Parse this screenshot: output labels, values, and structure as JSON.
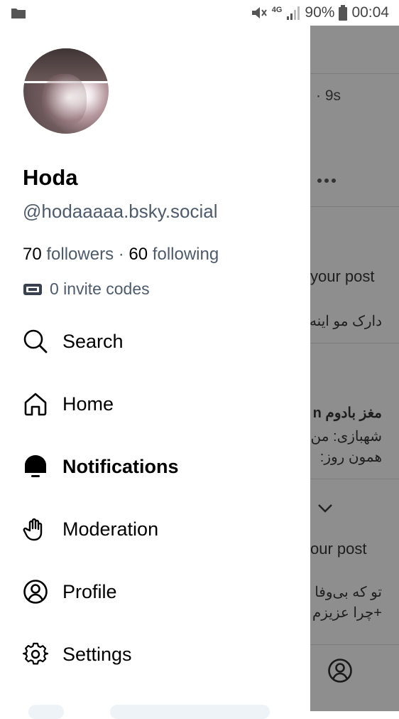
{
  "status_bar": {
    "battery": "90%",
    "time": "00:04",
    "network": "4G",
    "icons": [
      "folder-icon",
      "mute-icon",
      "signal-icon",
      "battery-icon"
    ]
  },
  "profile": {
    "display_name": "Hoda",
    "handle": "@hodaaaaa.bsky.social",
    "followers_count": "70",
    "followers_label": "followers",
    "separator": "·",
    "following_count": "60",
    "following_label": "following",
    "invite_codes": "0 invite codes"
  },
  "menu": {
    "items": [
      {
        "label": "Search",
        "icon": "search-icon"
      },
      {
        "label": "Home",
        "icon": "home-icon"
      },
      {
        "label": "Notifications",
        "icon": "bell-icon",
        "active": true
      },
      {
        "label": "Moderation",
        "icon": "hand-icon"
      },
      {
        "label": "Profile",
        "icon": "profile-icon"
      },
      {
        "label": "Settings",
        "icon": "gear-icon"
      }
    ]
  },
  "background_feed": {
    "time_ago": "· 9s",
    "text_1": "your post",
    "text_2": "دارک مو اینه",
    "text_3": "مغز بادوم n",
    "text_4": "شهبازی: من",
    "text_5": "همون روز:",
    "text_6": "our post",
    "text_7": "تو که بی‌وفا",
    "text_8": "+چرا عزیزم"
  },
  "colors": {
    "muted_text": "#4e5b6b",
    "overlay": "#8e8e8e"
  }
}
